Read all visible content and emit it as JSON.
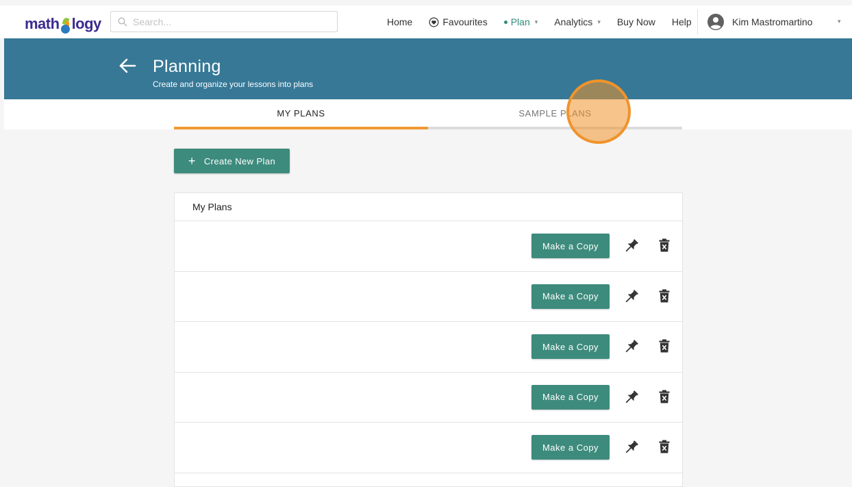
{
  "brand": {
    "logo_text_left": "math",
    "logo_text_right": "logy"
  },
  "search": {
    "placeholder": "Search..."
  },
  "nav": {
    "home": "Home",
    "favourites": "Favourites",
    "plan": "Plan",
    "analytics": "Analytics",
    "buy_now": "Buy Now",
    "help": "Help"
  },
  "user": {
    "name": "Kim Mastromartino"
  },
  "banner": {
    "title": "Planning",
    "subtitle": "Create and organize your lessons into plans"
  },
  "tabs": [
    {
      "label": "MY PLANS",
      "active": true
    },
    {
      "label": "SAMPLE PLANS",
      "active": false
    }
  ],
  "actions": {
    "create_label": "Create New Plan",
    "create_icon": "+"
  },
  "plans": {
    "header": "My Plans",
    "rows": [
      {
        "copy_label": "Make a Copy"
      },
      {
        "copy_label": "Make a Copy"
      },
      {
        "copy_label": "Make a Copy"
      },
      {
        "copy_label": "Make a Copy"
      },
      {
        "copy_label": "Make a Copy"
      }
    ]
  },
  "colors": {
    "banner": "#367896",
    "accent": "#3d8b7d",
    "active_tab": "#f09a2f",
    "cursor_highlight": "#f0932b"
  }
}
